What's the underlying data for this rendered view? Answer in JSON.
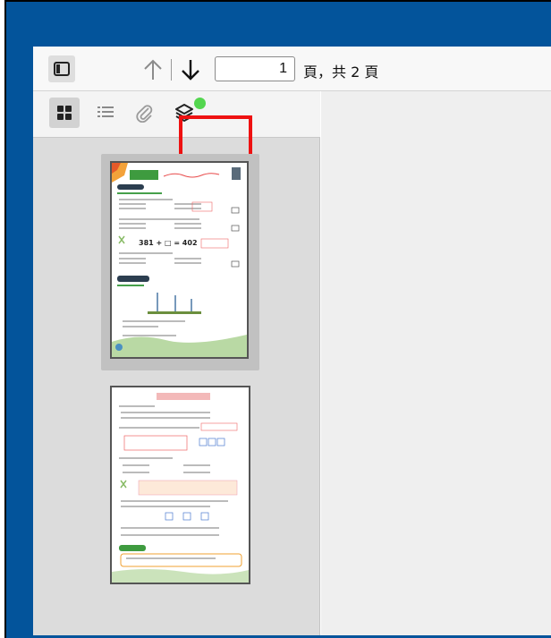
{
  "toolbar": {
    "page_input_value": "1",
    "page_count_text": "頁，共 2 頁"
  },
  "sidebar": {
    "tabs": [
      {
        "icon": "thumbnails-icon",
        "active": true
      },
      {
        "icon": "outline-icon",
        "active": false
      },
      {
        "icon": "attachments-icon",
        "active": false
      },
      {
        "icon": "layers-icon",
        "active": false,
        "badge_color": "#53d64f"
      }
    ],
    "thumbnails": [
      {
        "page": 1,
        "selected": true
      },
      {
        "page": 2,
        "selected": false
      }
    ]
  },
  "thumb1": {
    "equation": "381 + □ = 402"
  },
  "colors": {
    "titlebar": "#03549b",
    "highlight": "#ee1111",
    "badge": "#53d64f"
  }
}
